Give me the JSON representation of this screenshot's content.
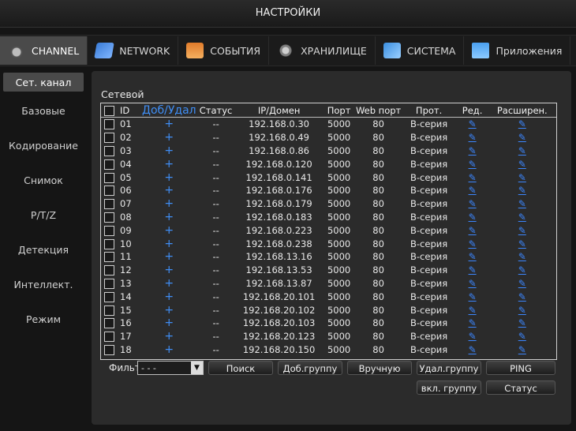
{
  "window": {
    "title": "НАСТРОЙКИ"
  },
  "tabs": [
    {
      "label": "CHANNEL",
      "icon": "channel-icon"
    },
    {
      "label": "NETWORK",
      "icon": "network-icon"
    },
    {
      "label": "СОБЫТИЯ",
      "icon": "events-icon"
    },
    {
      "label": "ХРАНИЛИЩЕ",
      "icon": "storage-icon"
    },
    {
      "label": "СИСТЕМА",
      "icon": "system-icon"
    },
    {
      "label": "Приложения",
      "icon": "apps-icon"
    }
  ],
  "sidebar": {
    "items": [
      {
        "label": "Сет. канал"
      },
      {
        "label": "Базовые"
      },
      {
        "label": "Кодирование"
      },
      {
        "label": "Снимок"
      },
      {
        "label": "P/T/Z"
      },
      {
        "label": "Детекция"
      },
      {
        "label": "Интеллект."
      },
      {
        "label": "Режим"
      }
    ]
  },
  "main": {
    "section_title": "Сетевой",
    "columns": [
      "ID",
      "Доб/Удал",
      "Статус",
      "IP/Домен",
      "Порт",
      "Web порт",
      "Прот.",
      "Ред.",
      "Расширен."
    ],
    "rows": [
      {
        "id": "01",
        "add": "+",
        "status": "--",
        "ip": "192.168.0.30",
        "port": "5000",
        "web": "80",
        "prot": "В-серия"
      },
      {
        "id": "02",
        "add": "+",
        "status": "--",
        "ip": "192.168.0.49",
        "port": "5000",
        "web": "80",
        "prot": "В-серия"
      },
      {
        "id": "03",
        "add": "+",
        "status": "--",
        "ip": "192.168.0.86",
        "port": "5000",
        "web": "80",
        "prot": "В-серия"
      },
      {
        "id": "04",
        "add": "+",
        "status": "--",
        "ip": "192.168.0.120",
        "port": "5000",
        "web": "80",
        "prot": "В-серия"
      },
      {
        "id": "05",
        "add": "+",
        "status": "--",
        "ip": "192.168.0.141",
        "port": "5000",
        "web": "80",
        "prot": "В-серия"
      },
      {
        "id": "06",
        "add": "+",
        "status": "--",
        "ip": "192.168.0.176",
        "port": "5000",
        "web": "80",
        "prot": "В-серия"
      },
      {
        "id": "07",
        "add": "+",
        "status": "--",
        "ip": "192.168.0.179",
        "port": "5000",
        "web": "80",
        "prot": "В-серия"
      },
      {
        "id": "08",
        "add": "+",
        "status": "--",
        "ip": "192.168.0.183",
        "port": "5000",
        "web": "80",
        "prot": "В-серия"
      },
      {
        "id": "09",
        "add": "+",
        "status": "--",
        "ip": "192.168.0.223",
        "port": "5000",
        "web": "80",
        "prot": "В-серия"
      },
      {
        "id": "10",
        "add": "+",
        "status": "--",
        "ip": "192.168.0.238",
        "port": "5000",
        "web": "80",
        "prot": "В-серия"
      },
      {
        "id": "11",
        "add": "+",
        "status": "--",
        "ip": "192.168.13.16",
        "port": "5000",
        "web": "80",
        "prot": "В-серия"
      },
      {
        "id": "12",
        "add": "+",
        "status": "--",
        "ip": "192.168.13.53",
        "port": "5000",
        "web": "80",
        "prot": "В-серия"
      },
      {
        "id": "13",
        "add": "+",
        "status": "--",
        "ip": "192.168.13.87",
        "port": "5000",
        "web": "80",
        "prot": "В-серия"
      },
      {
        "id": "14",
        "add": "+",
        "status": "--",
        "ip": "192.168.20.101",
        "port": "5000",
        "web": "80",
        "prot": "В-серия"
      },
      {
        "id": "15",
        "add": "+",
        "status": "--",
        "ip": "192.168.20.102",
        "port": "5000",
        "web": "80",
        "prot": "В-серия"
      },
      {
        "id": "16",
        "add": "+",
        "status": "--",
        "ip": "192.168.20.103",
        "port": "5000",
        "web": "80",
        "prot": "В-серия"
      },
      {
        "id": "17",
        "add": "+",
        "status": "--",
        "ip": "192.168.20.123",
        "port": "5000",
        "web": "80",
        "prot": "В-серия"
      },
      {
        "id": "18",
        "add": "+",
        "status": "--",
        "ip": "192.168.20.150",
        "port": "5000",
        "web": "80",
        "prot": "В-серия"
      }
    ],
    "filter_label": "Фильтр",
    "filter_value": "- - -",
    "buttons": {
      "search": "Поиск",
      "add_group": "Доб.группу",
      "manual": "Вручную",
      "del_group": "Удал.группу",
      "ping": "PING",
      "enable_group": "вкл. группу",
      "status": "Статус"
    }
  },
  "colors": {
    "accent": "#3f8ef5",
    "active_tab": "#4a4a4a",
    "panel": "#2b2b2b"
  }
}
